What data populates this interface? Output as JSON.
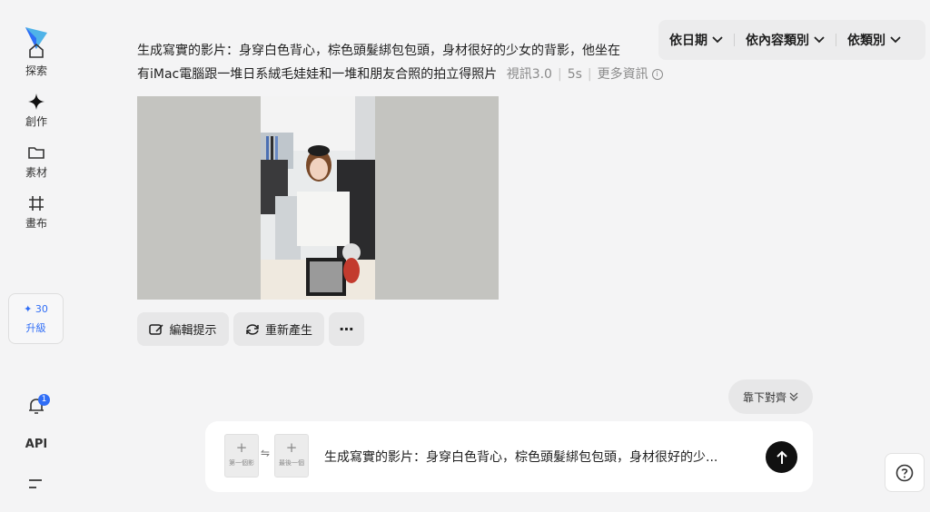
{
  "sidebar": {
    "items": [
      {
        "label": "探索",
        "icon": "home-icon"
      },
      {
        "label": "創作",
        "icon": "sparkle-icon"
      },
      {
        "label": "素材",
        "icon": "folder-icon"
      },
      {
        "label": "畫布",
        "icon": "canvas-icon"
      }
    ],
    "upgrade": {
      "credits": "✦ 30",
      "label": "升級"
    },
    "notification_count": "1",
    "api_label": "API"
  },
  "filters": [
    {
      "label": "依日期"
    },
    {
      "label": "依內容類別"
    },
    {
      "label": "依類別"
    }
  ],
  "generation": {
    "prompt_line1": "生成寫實的影片：身穿白色背心，棕色頭髮綁包包頭，身材很好的少女的背影，他坐在",
    "prompt_line2": "有iMac電腦跟一堆日系絨毛娃娃和一堆和朋友合照的拍立得照片",
    "model": "視訊3.0",
    "duration": "5s",
    "more_info": "更多資訊"
  },
  "actions": {
    "edit_prompt": "編輯提示",
    "regenerate": "重新產生",
    "more": "⋯"
  },
  "align_button": "靠下對齊",
  "composer": {
    "first_frame": "第一個影",
    "last_frame": "最後一個",
    "prompt_preview": "生成寫實的影片：身穿白色背心，棕色頭髮綁包包頭，身材很好的少..."
  },
  "colors": {
    "accent": "#2f6df6",
    "background": "#f4f4f5",
    "button_bg": "#e7e7e8",
    "send_button": "#111111"
  }
}
